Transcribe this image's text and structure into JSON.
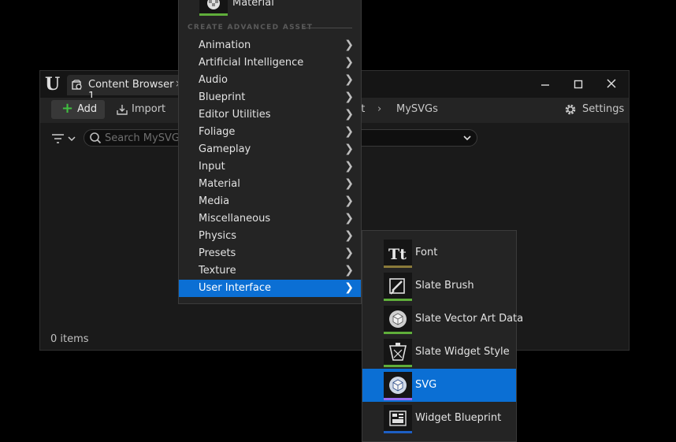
{
  "window": {
    "tab_label": "Content Browser 1",
    "tab_close": "×"
  },
  "toolbar": {
    "add_label": "Add",
    "import_label": "Import",
    "breadcrumb": [
      "nt",
      "MySVGs"
    ],
    "settings_label": "Settings"
  },
  "search": {
    "placeholder": "Search MySVGs"
  },
  "status": {
    "items_label": "0 items"
  },
  "menu": {
    "top_item_label": "Material",
    "section_header": "CREATE ADVANCED ASSET",
    "items": [
      {
        "label": "Animation"
      },
      {
        "label": "Artificial Intelligence"
      },
      {
        "label": "Audio"
      },
      {
        "label": "Blueprint"
      },
      {
        "label": "Editor Utilities"
      },
      {
        "label": "Foliage"
      },
      {
        "label": "Gameplay"
      },
      {
        "label": "Input"
      },
      {
        "label": "Material"
      },
      {
        "label": "Media"
      },
      {
        "label": "Miscellaneous"
      },
      {
        "label": "Physics"
      },
      {
        "label": "Presets"
      },
      {
        "label": "Texture"
      },
      {
        "label": "User Interface"
      }
    ],
    "active_item": "User Interface"
  },
  "submenu": {
    "items": [
      {
        "label": "Font",
        "icon": "font-icon",
        "bar_color": "#8a7a3a"
      },
      {
        "label": "Slate Brush",
        "icon": "slate-brush-icon",
        "bar_color": "#5fae3a"
      },
      {
        "label": "Slate Vector Art Data",
        "icon": "slate-vector-art-icon",
        "bar_color": "#5fae3a"
      },
      {
        "label": "Slate Widget Style",
        "icon": "slate-widget-style-icon",
        "bar_color": "#5fae3a"
      },
      {
        "label": "SVG",
        "icon": "svg-icon",
        "bar_color": "#9b6cf2"
      },
      {
        "label": "Widget Blueprint",
        "icon": "widget-blueprint-icon",
        "bar_color": "#1d5fc4"
      }
    ],
    "active_item": "SVG"
  },
  "colors": {
    "highlight": "#0b6fd4",
    "add_plus": "#3fbf3f",
    "panel_bg": "#242424",
    "window_bg": "#1a1a1a"
  }
}
